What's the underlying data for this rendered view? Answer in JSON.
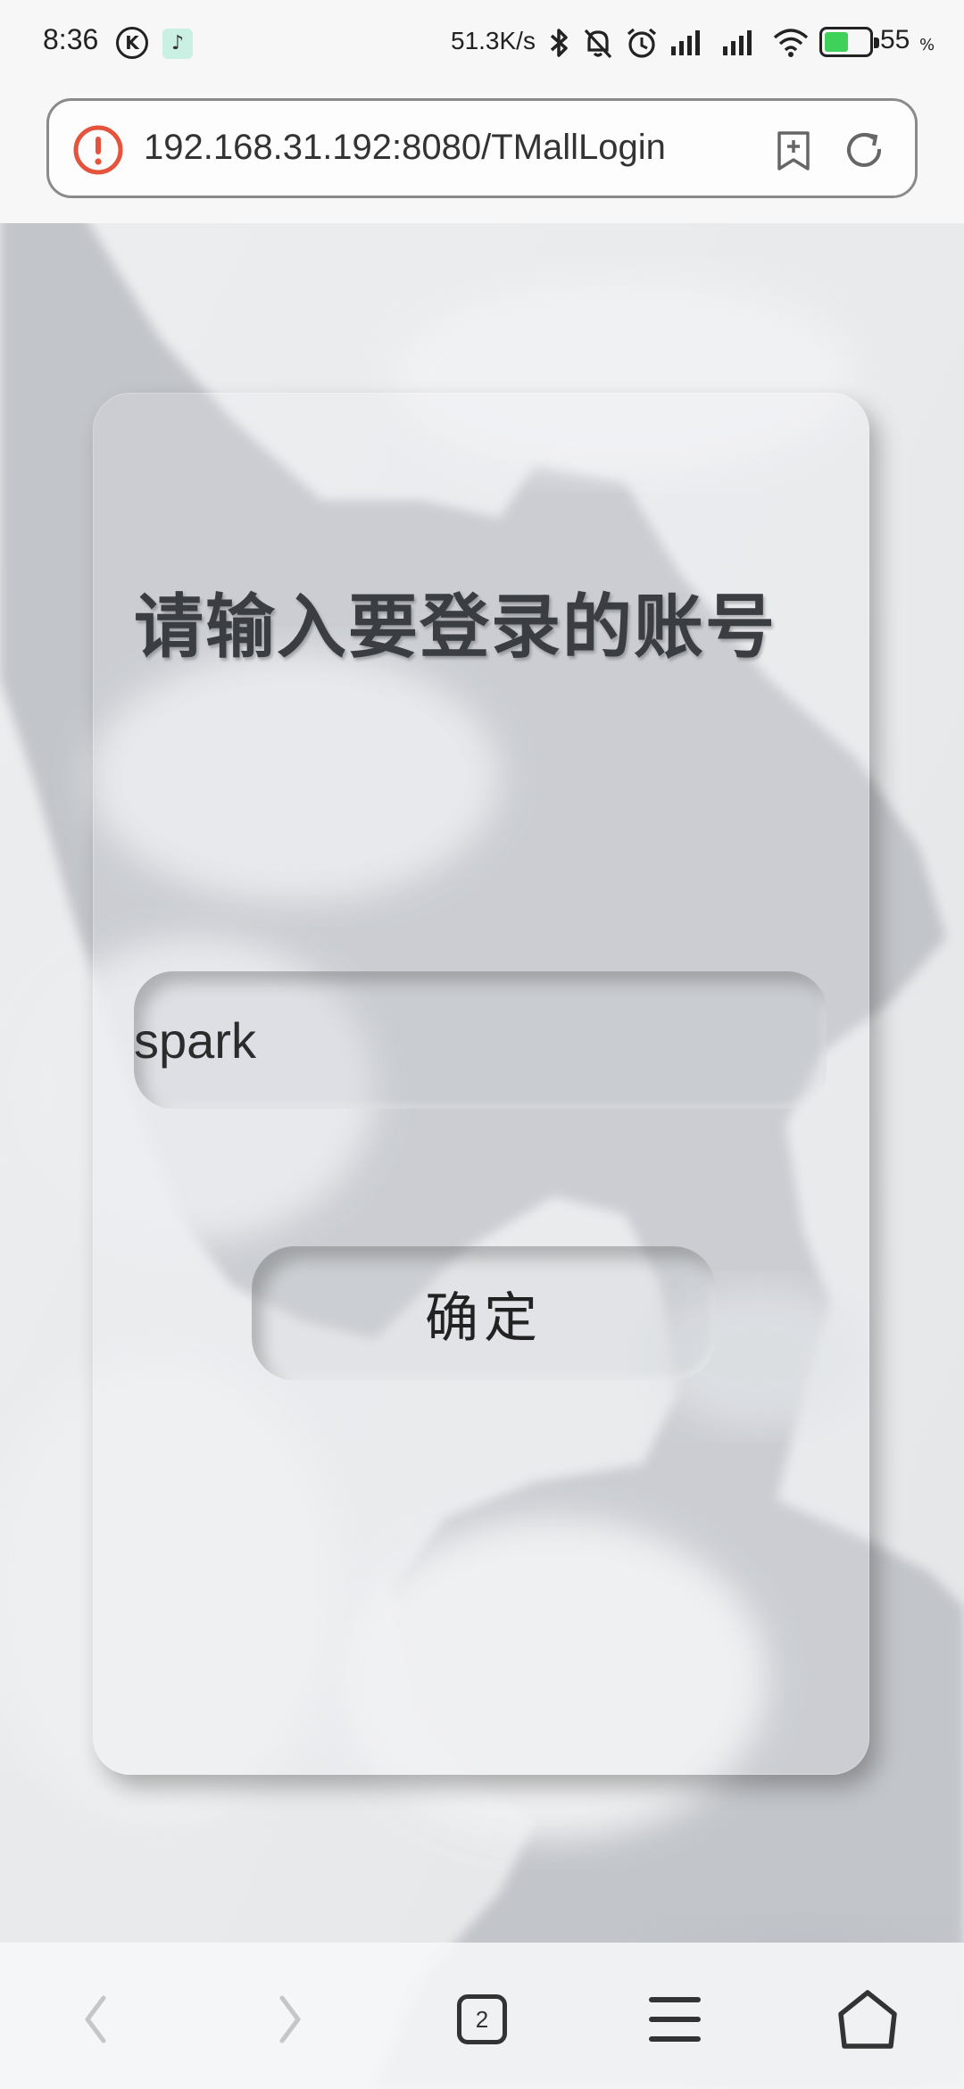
{
  "status_bar": {
    "time": "8:36",
    "k_icon": "K",
    "network_speed": "51.3K/s",
    "battery_level": "55",
    "battery_unit": "%",
    "battery_fraction": 0.55,
    "battery_color": "#3fd15a"
  },
  "browser": {
    "url": "192.168.31.192:8080/TMallLogin",
    "security_icon": "warning-icon",
    "warning_color": "#e5533d"
  },
  "login": {
    "title": "请输入要登录的账号",
    "account_value": "spark",
    "confirm_label": "确定"
  },
  "bottom_nav": {
    "tab_count": "2"
  }
}
